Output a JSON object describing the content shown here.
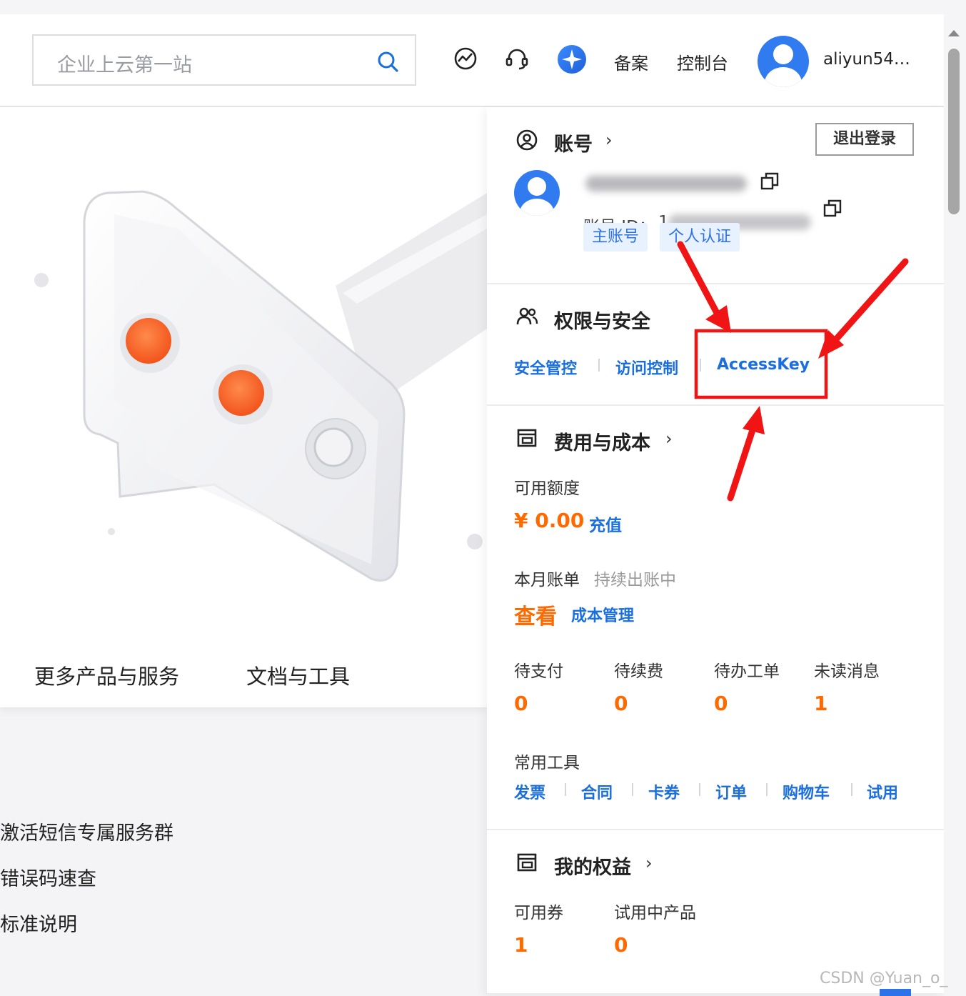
{
  "header": {
    "search_placeholder": "企业上云第一站",
    "icons": [
      "search-icon",
      "dashboard-icon",
      "headset-icon",
      "ai-assistant-icon"
    ],
    "nav": [
      "备案",
      "控制台"
    ],
    "username": "aliyun54…"
  },
  "hero": {
    "tabs": [
      "更多产品与服务",
      "文档与工具"
    ]
  },
  "left_links": [
    "激活短信专属服务群",
    "错误码速查",
    "标准说明"
  ],
  "account_panel": {
    "account": {
      "title": "账号",
      "logout": "退出登录",
      "id_label": "账号 ID：",
      "id_prefix": "1",
      "tags": [
        "主账号",
        "个人认证"
      ]
    },
    "security": {
      "title": "权限与安全",
      "links": [
        "安全管控",
        "访问控制",
        "AccessKey"
      ]
    },
    "billing": {
      "title": "费用与成本",
      "available_label": "可用额度",
      "balance": "¥ 0.00",
      "recharge": "充值",
      "monthly_label": "本月账单",
      "monthly_status": "持续出账中",
      "view": "查看",
      "cost_mgmt": "成本管理",
      "stats": [
        {
          "label": "待支付",
          "value": "0"
        },
        {
          "label": "待续费",
          "value": "0"
        },
        {
          "label": "待办工单",
          "value": "0"
        },
        {
          "label": "未读消息",
          "value": "1"
        }
      ],
      "tools_label": "常用工具",
      "tools": [
        "发票",
        "合同",
        "卡券",
        "订单",
        "购物车",
        "试用"
      ]
    },
    "benefits": {
      "title": "我的权益",
      "stats": [
        {
          "label": "可用券",
          "value": "1"
        },
        {
          "label": "试用中产品",
          "value": "0"
        }
      ]
    }
  },
  "colors": {
    "link_blue": "#1a6fde",
    "orange": "#ff6a00",
    "annotation_red": "#f01414",
    "avatar_blue": "#2f7bef"
  },
  "watermark": "CSDN @Yuan_o_"
}
